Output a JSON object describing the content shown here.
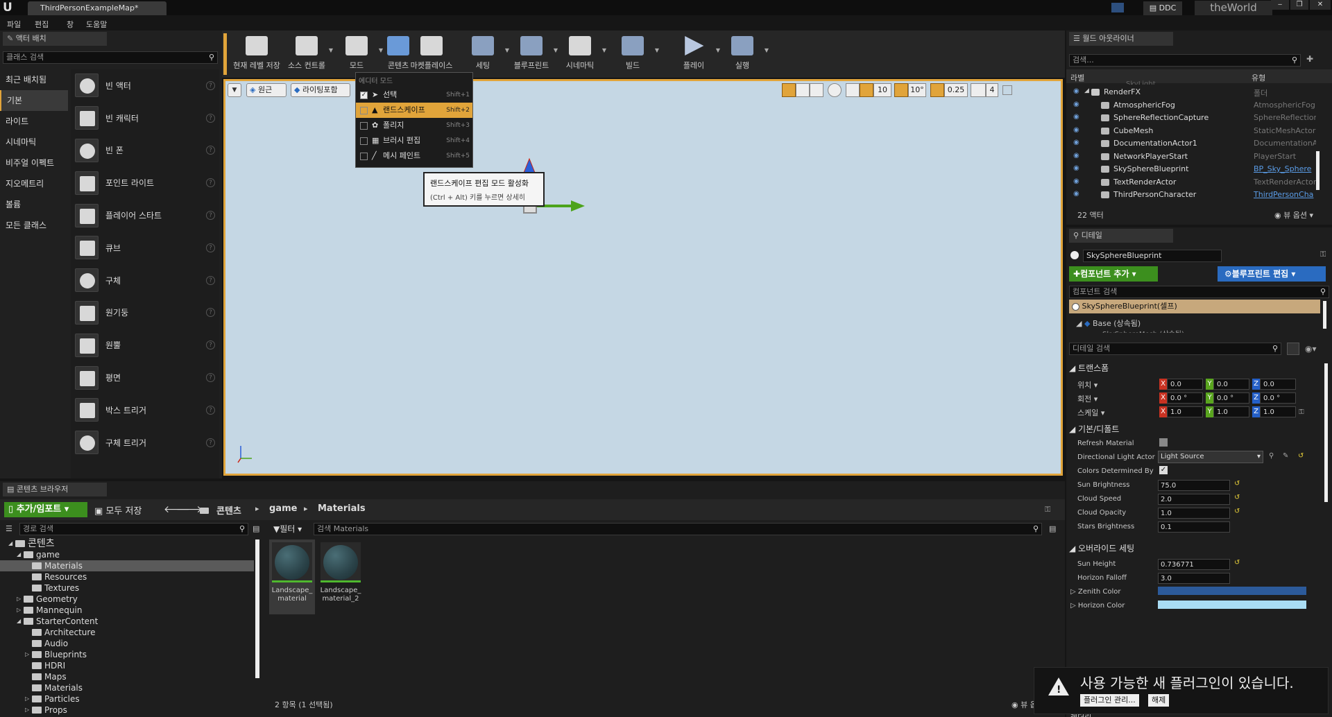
{
  "window": {
    "logo": "U",
    "tab_title": "ThirdPersonExampleMap*",
    "ddc": "DDC",
    "project": "theWorld",
    "controls": [
      "‒",
      "❐",
      "✕"
    ]
  },
  "menu": [
    "파일",
    "편집",
    "창",
    "도움말"
  ],
  "actor_panel": {
    "tab": "액터 배치",
    "search_placeholder": "클래스 검색",
    "categories": [
      "최근 배치됨",
      "기본",
      "라이트",
      "시네마틱",
      "비주얼 이펙트",
      "지오메트리",
      "볼륨",
      "모든 클래스"
    ],
    "items": [
      "빈 액터",
      "빈 캐릭터",
      "빈 폰",
      "포인트 라이트",
      "플레이어 스타트",
      "큐브",
      "구체",
      "원기둥",
      "원뿔",
      "평면",
      "박스 트리거",
      "구체 트리거"
    ]
  },
  "toolbar": {
    "buttons": [
      "현재 레벨 저장",
      "소스 컨트롤",
      "모드",
      "콘텐츠",
      "마켓플레이스",
      "세팅",
      "블루프린트",
      "시네마틱",
      "빌드",
      "플레이",
      "실행"
    ]
  },
  "viewport": {
    "left_buttons": [
      "원근",
      "라이팅포함"
    ],
    "snap_values": [
      "10",
      "10°",
      "0.25",
      "4"
    ]
  },
  "mode_menu": {
    "header": "에디터 모드",
    "items": [
      {
        "label": "선택",
        "shortcut": "Shift+1",
        "checked": true
      },
      {
        "label": "랜드스케이프",
        "shortcut": "Shift+2",
        "checked": false
      },
      {
        "label": "폴리지",
        "shortcut": "Shift+3",
        "checked": false
      },
      {
        "label": "브러시 편집",
        "shortcut": "Shift+4",
        "checked": false
      },
      {
        "label": "메시 페인트",
        "shortcut": "Shift+5",
        "checked": false
      }
    ]
  },
  "tooltip": {
    "line1": "랜드스케이프 편집 모드 활성화",
    "line2": "(Ctrl + Alt) 키를 누르면 상세히"
  },
  "outliner": {
    "tab": "월드 아웃라이너",
    "search_placeholder": "검색...",
    "col_label": "라벨",
    "col_type": "유형",
    "cut_row": "SkyLight",
    "rows": [
      {
        "label": "RenderFX",
        "type": "폴더",
        "link": false
      },
      {
        "label": "AtmosphericFog",
        "type": "AtmosphericFog",
        "link": false
      },
      {
        "label": "SphereReflectionCapture",
        "type": "SphereReflectionC",
        "link": false
      },
      {
        "label": "CubeMesh",
        "type": "StaticMeshActor",
        "link": false
      },
      {
        "label": "DocumentationActor1",
        "type": "DocumentationAc",
        "link": false
      },
      {
        "label": "NetworkPlayerStart",
        "type": "PlayerStart",
        "link": false
      },
      {
        "label": "SkySphereBlueprint",
        "type": "BP_Sky_Sphere",
        "link": true
      },
      {
        "label": "TextRenderActor",
        "type": "TextRenderActor",
        "link": false
      },
      {
        "label": "ThirdPersonCharacter",
        "type": "ThirdPersonCha",
        "link": true
      }
    ],
    "count": "22 액터",
    "view_options": "뷰 옵션"
  },
  "details": {
    "tab": "디테일",
    "actor_name": "SkySphereBlueprint",
    "add_component": "컴포넌트 추가",
    "edit_blueprint": "블루프린트 편집",
    "component_search": "컴포넌트 검색",
    "self_row": "SkySphereBlueprint(셀프)",
    "base_row": "Base (상속됨)",
    "cut_row": "SkySphereMesh (상속됨)",
    "detail_search": "디테일 검색",
    "transform": {
      "header": "트랜스폼",
      "location": {
        "label": "위치",
        "x": "0.0",
        "y": "0.0",
        "z": "0.0"
      },
      "rotation": {
        "label": "회전",
        "x": "0.0 °",
        "y": "0.0 °",
        "z": "0.0 °"
      },
      "scale": {
        "label": "스케일",
        "x": "1.0",
        "y": "1.0",
        "z": "1.0"
      }
    },
    "default": {
      "header": "기본/디폴트",
      "refresh_material": "Refresh Material",
      "directional_light": "Directional Light Actor",
      "light_source": "Light Source",
      "colors_determined": "Colors Determined By",
      "sun_brightness": "Sun Brightness",
      "sun_brightness_val": "75.0",
      "cloud_speed": "Cloud Speed",
      "cloud_speed_val": "2.0",
      "cloud_opacity": "Cloud Opacity",
      "cloud_opacity_val": "1.0",
      "stars_brightness": "Stars Brightness",
      "stars_brightness_val": "0.1"
    },
    "override": {
      "header": "오버라이드 세팅",
      "sun_height": "Sun Height",
      "sun_height_val": "0.736771",
      "horizon_falloff": "Horizon Falloff",
      "horizon_falloff_val": "3.0",
      "zenith_color": "Zenith Color",
      "horizon_color": "Horizon Color"
    },
    "cut_header": "레더린"
  },
  "content_browser": {
    "tab": "콘텐츠 브라우저",
    "add_import": "추가/임포트",
    "save_all": "모두 저장",
    "path": [
      "콘텐츠",
      "game",
      "Materials"
    ],
    "path_search": "경로 검색",
    "filter": "필터",
    "search_placeholder": "검색 Materials",
    "tree": [
      {
        "label": "콘텐츠",
        "level": 0,
        "arrow": "◢",
        "selected": false
      },
      {
        "label": "game",
        "level": 1,
        "arrow": "◢",
        "selected": false
      },
      {
        "label": "Materials",
        "level": 2,
        "arrow": "",
        "selected": true
      },
      {
        "label": "Resources",
        "level": 2,
        "arrow": "",
        "selected": false
      },
      {
        "label": "Textures",
        "level": 2,
        "arrow": "",
        "selected": false
      },
      {
        "label": "Geometry",
        "level": 1,
        "arrow": "▷",
        "selected": false
      },
      {
        "label": "Mannequin",
        "level": 1,
        "arrow": "▷",
        "selected": false
      },
      {
        "label": "StarterContent",
        "level": 1,
        "arrow": "◢",
        "selected": false
      },
      {
        "label": "Architecture",
        "level": 2,
        "arrow": "",
        "selected": false
      },
      {
        "label": "Audio",
        "level": 2,
        "arrow": "",
        "selected": false
      },
      {
        "label": "Blueprints",
        "level": 2,
        "arrow": "▷",
        "selected": false
      },
      {
        "label": "HDRI",
        "level": 2,
        "arrow": "",
        "selected": false
      },
      {
        "label": "Maps",
        "level": 2,
        "arrow": "",
        "selected": false
      },
      {
        "label": "Materials",
        "level": 2,
        "arrow": "",
        "selected": false
      },
      {
        "label": "Particles",
        "level": 2,
        "arrow": "▷",
        "selected": false
      },
      {
        "label": "Props",
        "level": 2,
        "arrow": "▷",
        "selected": false
      }
    ],
    "assets": [
      {
        "name": "Landscape_\nmaterial"
      },
      {
        "name": "Landscape_\nmaterial_2"
      }
    ],
    "status": "2 항목 (1 선택됨)",
    "view_options": "뷰 옵션"
  },
  "notification": {
    "text": "사용 가능한 새 플러그인이 있습니다.",
    "manage": "플러그인 관리...",
    "dismiss": "해제"
  },
  "colors": {
    "accent_green": "#3c8f1e",
    "accent_blue": "#2a6bc0",
    "selection_orange": "#f5a623",
    "viewport_bg": "#c9d8e4"
  }
}
